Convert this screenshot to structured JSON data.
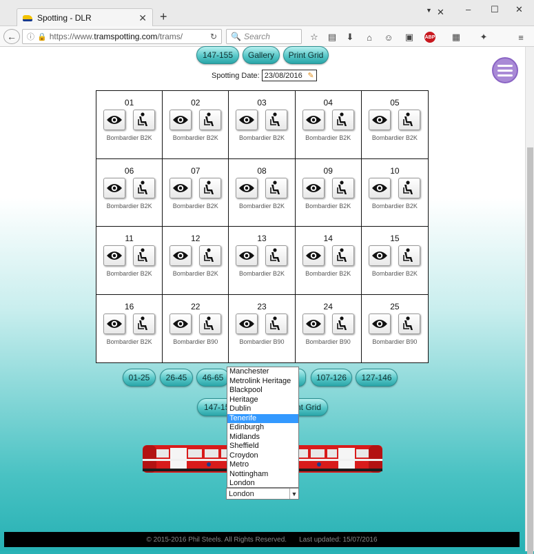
{
  "browser": {
    "tab_title": "Spotting - DLR",
    "new_tab": "+",
    "url_prefix": "https://www.",
    "url_host": "tramspotting.com",
    "url_path": "/trams/",
    "search_placeholder": "Search",
    "minimize": "–",
    "maximize": "☐",
    "close": "✕"
  },
  "top_nav": {
    "prev": "147-155",
    "gallery": "Gallery",
    "print": "Print Grid"
  },
  "spotting_date": {
    "label": "Spotting Date:",
    "value": "23/08/2016"
  },
  "trams": [
    {
      "no": "01",
      "model": "Bombardier B2K"
    },
    {
      "no": "02",
      "model": "Bombardier B2K"
    },
    {
      "no": "03",
      "model": "Bombardier B2K"
    },
    {
      "no": "04",
      "model": "Bombardier B2K"
    },
    {
      "no": "05",
      "model": "Bombardier B2K"
    },
    {
      "no": "06",
      "model": "Bombardier B2K"
    },
    {
      "no": "07",
      "model": "Bombardier B2K"
    },
    {
      "no": "08",
      "model": "Bombardier B2K"
    },
    {
      "no": "09",
      "model": "Bombardier B2K"
    },
    {
      "no": "10",
      "model": "Bombardier B2K"
    },
    {
      "no": "11",
      "model": "Bombardier B2K"
    },
    {
      "no": "12",
      "model": "Bombardier B2K"
    },
    {
      "no": "13",
      "model": "Bombardier B2K"
    },
    {
      "no": "14",
      "model": "Bombardier B2K"
    },
    {
      "no": "15",
      "model": "Bombardier B2K"
    },
    {
      "no": "16",
      "model": "Bombardier B2K"
    },
    {
      "no": "22",
      "model": "Bombardier B90"
    },
    {
      "no": "23",
      "model": "Bombardier B90"
    },
    {
      "no": "24",
      "model": "Bombardier B90"
    },
    {
      "no": "25",
      "model": "Bombardier B90"
    }
  ],
  "pagination": [
    "01-25",
    "26-45",
    "46-65",
    "107-126",
    "127-146"
  ],
  "bottom_nav": {
    "prev": "147-155",
    "print": "Print Grid"
  },
  "network_select": {
    "options": [
      "Manchester",
      "Metrolink Heritage",
      "Blackpool",
      "Heritage",
      "Dublin",
      "Tenerife",
      "Edinburgh",
      "Midlands",
      "Sheffield",
      "Croydon",
      "Metro",
      "Nottingham",
      "London"
    ],
    "highlighted": "Tenerife",
    "selected": "London"
  },
  "footer": {
    "copyright": "© 2015-2016 Phil Steels. All Rights Reserved.",
    "updated": "Last updated: 15/07/2016"
  },
  "colors": {
    "pill": "#58c7c8",
    "hamburger": "#a98ad6",
    "highlight": "#3399ff",
    "train_red": "#d81b1b"
  }
}
